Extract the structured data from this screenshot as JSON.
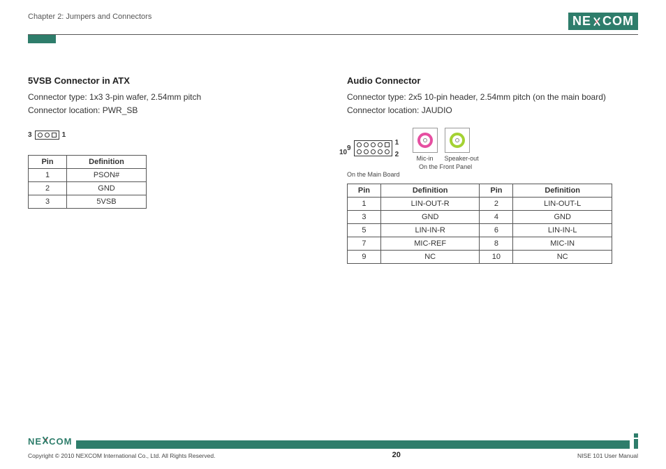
{
  "header": {
    "chapter": "Chapter 2: Jumpers and Connectors",
    "logo_left": "NE",
    "logo_right": "COM"
  },
  "left": {
    "title": "5VSB Connector in ATX",
    "type_line": "Connector type: 1x3 3-pin wafer, 2.54mm pitch",
    "loc_line": "Connector location: PWR_SB",
    "pin_left": "3",
    "pin_right": "1",
    "th_pin": "Pin",
    "th_def": "Definition",
    "rows": [
      {
        "pin": "1",
        "def": "PSON#"
      },
      {
        "pin": "2",
        "def": "GND"
      },
      {
        "pin": "3",
        "def": "5VSB"
      }
    ]
  },
  "right": {
    "title": "Audio Connector",
    "type_line": "Connector type: 2x5 10-pin header,  2.54mm pitch (on the main board)",
    "loc_line": "Connector location: JAUDIO",
    "hdr_top_left": "9",
    "hdr_top_right": "1",
    "hdr_bot_left": "10",
    "hdr_bot_right": "2",
    "onboard": "On the Main Board",
    "mic": "Mic-in",
    "spk": "Speaker-out",
    "panel": "On the Front Panel",
    "th_pin": "Pin",
    "th_def": "Definition",
    "rows": [
      {
        "p1": "1",
        "d1": "LIN-OUT-R",
        "p2": "2",
        "d2": "LIN-OUT-L"
      },
      {
        "p1": "3",
        "d1": "GND",
        "p2": "4",
        "d2": "GND"
      },
      {
        "p1": "5",
        "d1": "LIN-IN-R",
        "p2": "6",
        "d2": "LIN-IN-L"
      },
      {
        "p1": "7",
        "d1": "MIC-REF",
        "p2": "8",
        "d2": "MIC-IN"
      },
      {
        "p1": "9",
        "d1": "NC",
        "p2": "10",
        "d2": "NC"
      }
    ]
  },
  "footer": {
    "logo_left": "NE",
    "logo_right": "COM",
    "copyright": "Copyright © 2010 NEXCOM International Co., Ltd. All Rights Reserved.",
    "page": "20",
    "manual": "NISE 101 User Manual"
  }
}
